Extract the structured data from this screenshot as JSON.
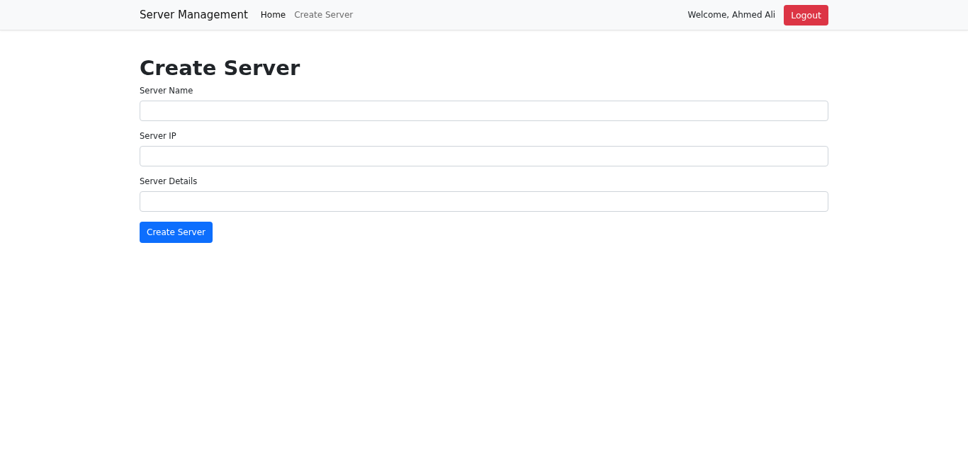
{
  "navbar": {
    "brand": "Server Management",
    "links": [
      {
        "label": "Home",
        "selected": true
      },
      {
        "label": "Create Server",
        "selected": false
      }
    ],
    "welcome": "Welcome, Ahmed Ali",
    "logout": "Logout"
  },
  "form": {
    "title": "Create Server",
    "fields": [
      {
        "label": "Server Name"
      },
      {
        "label": "Server IP"
      },
      {
        "label": "Server Details"
      }
    ],
    "submit": "Create Server"
  }
}
